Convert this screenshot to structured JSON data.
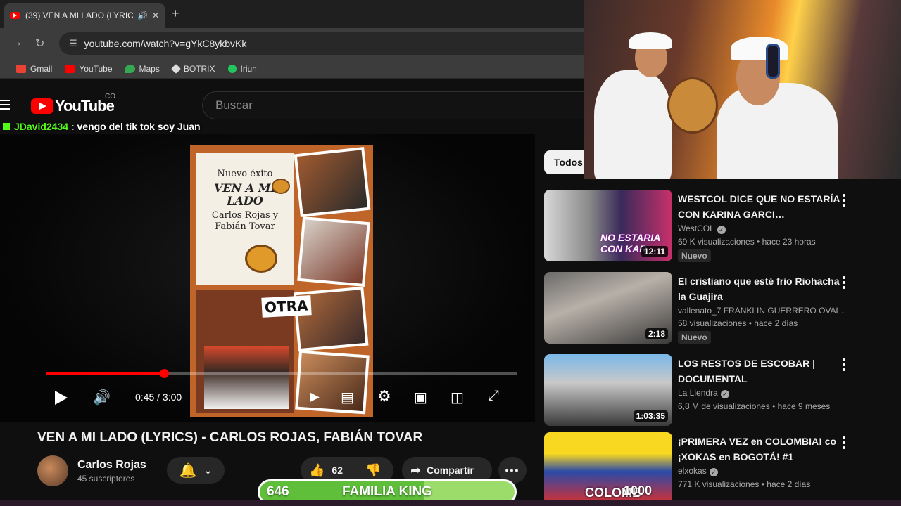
{
  "browser": {
    "tab_title": "(39) VEN A MI LADO (LYRIC",
    "url": "youtube.com/watch?v=gYkC8ykbvKk",
    "bookmarks": [
      {
        "label": "Gmail",
        "color": "#ea4335"
      },
      {
        "label": "YouTube",
        "color": "#ff0000"
      },
      {
        "label": "Maps",
        "color": "#34a853"
      },
      {
        "label": "BOTRIX",
        "color": "#dddddd"
      },
      {
        "label": "Iriun",
        "color": "#22c55e"
      }
    ]
  },
  "youtube": {
    "logo_text": "YouTube",
    "country_code": "CO",
    "search_placeholder": "Buscar"
  },
  "chat": {
    "user": "JDavid2434",
    "message": ": vengo del tik tok soy Juan"
  },
  "thumbnail": {
    "line1": "Nuevo éxito",
    "line2": "VEN A MI LADO",
    "line3": "Carlos Rojas y Fabián Tovar",
    "sticker": "OTRA"
  },
  "player": {
    "progress_fraction": 0.25,
    "time_display": "0:45 / 3:00"
  },
  "video": {
    "title": "VEN A MI LADO (LYRICS) - CARLOS ROJAS, FABIÁN TOVAR",
    "channel": "Carlos Rojas",
    "subscribers": "45 suscriptores",
    "likes": "62",
    "share_label": "Compartir"
  },
  "recommendations": {
    "chip": "Todos",
    "items": [
      {
        "title": "WESTCOL DICE QUE NO ESTARÍA CON KARINA GARCI…",
        "channel": "WestCOL",
        "verified": true,
        "views": "69 K visualizaciones • hace 23 horas",
        "badge": "Nuevo",
        "duration": "12:11",
        "thumb_text": "NO ESTARIA CON KAR"
      },
      {
        "title": "El cristiano que esté frio Riohacha la Guajira",
        "channel": "vallenato_7 FRANKLIN GUERRERO OVAL…",
        "verified": false,
        "views": "58 visualizaciones • hace 2 días",
        "badge": "Nuevo",
        "duration": "2:18",
        "thumb_text": ""
      },
      {
        "title": "LOS RESTOS DE ESCOBAR | DOCUMENTAL",
        "channel": "La Liendra",
        "verified": true,
        "views": "6,8 M de visualizaciones • hace 9 meses",
        "badge": "",
        "duration": "1:03:35",
        "thumb_text": ""
      },
      {
        "title": "¡PRIMERA VEZ en COLOMBIA! co ¡XOKAS en BOGOTÁ! #1",
        "channel": "elxokas",
        "verified": true,
        "views": "771 K visualizaciones • hace 2 días",
        "badge": "",
        "duration": "",
        "thumb_text": "COLOMB"
      }
    ]
  },
  "goal": {
    "current": "646",
    "label": "FAMILIA KING",
    "target": "1000",
    "fraction": 0.646
  }
}
